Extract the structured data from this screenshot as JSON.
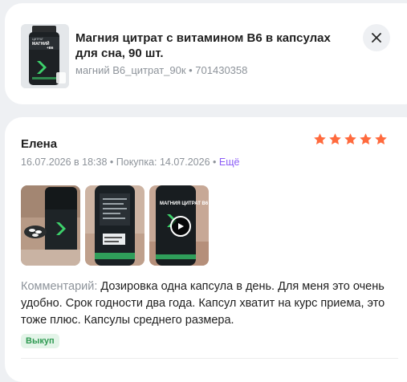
{
  "product": {
    "title": "Магния цитрат с витамином В6 в капсулах для сна, 90 шт.",
    "sku": "магний В6_цитрат_90к • 701430358",
    "image_icon": "supplement-bottle",
    "package_text_top": "ЦИТРАТ",
    "package_text_mid": "МАГНИЙ",
    "package_text_b6": "+B6"
  },
  "review": {
    "author": "Елена",
    "date": "16.07.2026 в 18:38",
    "purchase": " • Покупка: 14.07.2026 • ",
    "more_label": "Ещё",
    "rating": 5,
    "comment_label": "Комментарий:",
    "comment_text": " Дозировка одна капсула в день. Для меня это очень удобно. Срок годности два года. Капсул хватит на курс приема, это тоже плюс. Капсулы среднего размера.",
    "badge": "Выкуп",
    "photos": [
      "photo-open-bottle",
      "photo-bottle-back",
      "video-bottle-front"
    ],
    "video_icon": "play-icon",
    "bottle_label_text": "МАГНИЯ ЦИТРАТ В6"
  },
  "colors": {
    "star": "#ff6a3d",
    "link": "#8b5cf6",
    "badge_bg": "#e3f4e8",
    "badge_text": "#2f9a52"
  }
}
